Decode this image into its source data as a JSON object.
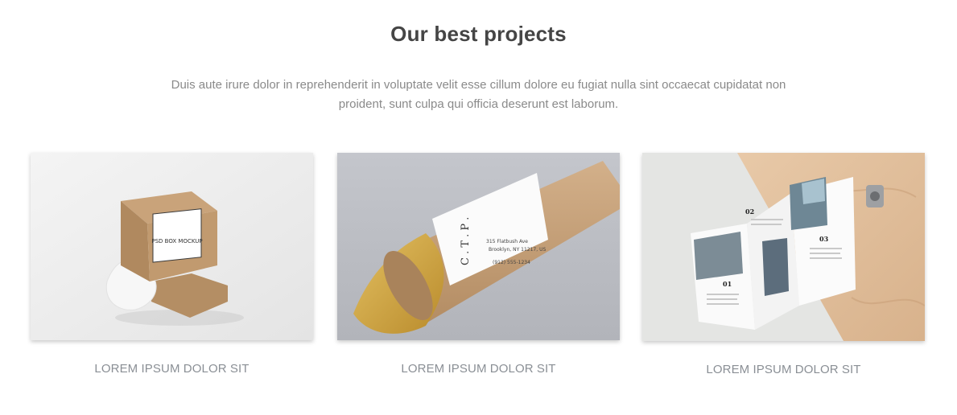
{
  "section": {
    "title": "Our best projects",
    "description": "Duis aute irure dolor in reprehenderit in voluptate velit esse cillum dolore eu fugiat nulla sint occaecat cupidatat non proident, sunt culpa qui officia deserunt est laborum."
  },
  "projects": [
    {
      "caption": "LOREM IPSUM DOLOR SIT",
      "image_label": "PSD BOX MOCKUP"
    },
    {
      "caption": "LOREM IPSUM DOLOR SIT",
      "image_label": "C . T . P .",
      "address_line_1": "315 Flatbush Ave",
      "address_line_2": "Brooklyn, NY 11217, US",
      "phone": "(912) 555-1234"
    },
    {
      "caption": "LOREM IPSUM DOLOR SIT",
      "panel_numbers": [
        "01",
        "02",
        "03"
      ]
    }
  ]
}
